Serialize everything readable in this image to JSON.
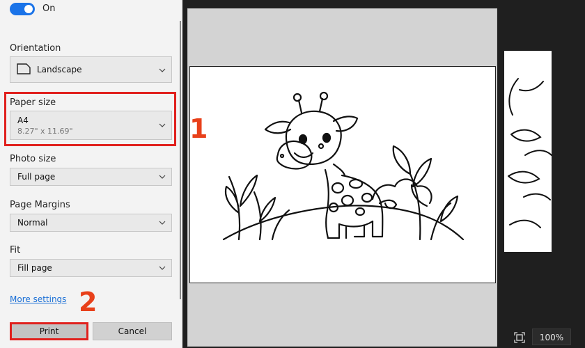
{
  "toggle": {
    "label": "On",
    "state": "on"
  },
  "orientation": {
    "label": "Orientation",
    "value": "Landscape"
  },
  "paper_size": {
    "label": "Paper size",
    "value": "A4",
    "dimensions": "8.27\" x 11.69\""
  },
  "photo_size": {
    "label": "Photo size",
    "value": "Full page"
  },
  "page_margins": {
    "label": "Page Margins",
    "value": "Normal"
  },
  "fit": {
    "label": "Fit",
    "value": "Fill page"
  },
  "more_settings": "More settings",
  "buttons": {
    "print": "Print",
    "cancel": "Cancel"
  },
  "annotations": {
    "step1": "1",
    "step2": "2"
  },
  "zoom": "100%",
  "colors": {
    "accent": "#1a73e8",
    "highlight": "#e0201d",
    "step_number": "#e8401a",
    "link": "#1a6fd6"
  },
  "icons": [
    "page-landscape-icon",
    "chevron-down-icon",
    "fit-to-window-icon"
  ]
}
